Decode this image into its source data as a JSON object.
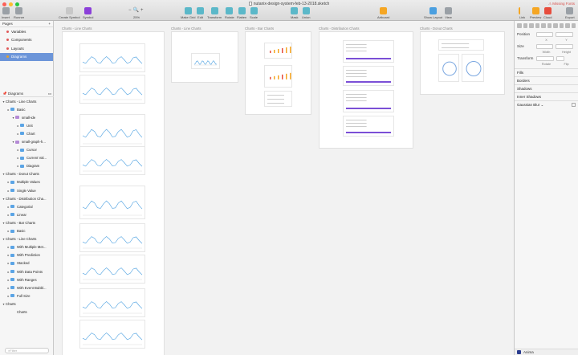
{
  "window": {
    "title": "nutanix-design-system-feb-13-2018.sketch",
    "missing_fonts": "Missing Fonts"
  },
  "toolbar": {
    "insert": "Insert",
    "runner": "Runner",
    "create_symbol": "Create Symbol",
    "symbol": "Symbol",
    "zoom": "25%",
    "make_grid": "Make Grid",
    "edit": "Edit",
    "transform": "Transform",
    "rotate": "Rotate",
    "flatten": "Flatten",
    "scale": "Scale",
    "mask": "Mask",
    "union": "Union",
    "artboard": "Artboard",
    "show_layout": "Show Layout",
    "view": "View",
    "link": "Link",
    "preview": "Preview",
    "cloud": "Cloud",
    "export": "Export"
  },
  "pages": {
    "header": "Pages",
    "items": [
      {
        "label": "Variables",
        "color": "#e05a5a"
      },
      {
        "label": "Components",
        "color": "#e05a5a"
      },
      {
        "label": "Layouts",
        "color": "#e05a5a"
      },
      {
        "label": "Diagrams",
        "color": "#e0a030"
      }
    ]
  },
  "layers": {
    "header": "Diagrams",
    "items": [
      {
        "label": "Charts - Line Charts",
        "level": 0,
        "kind": "board"
      },
      {
        "label": "Basic",
        "level": 1,
        "kind": "folder"
      },
      {
        "label": "small-ide",
        "level": 2,
        "kind": "symbol"
      },
      {
        "label": "Unit",
        "level": 3,
        "kind": "folder"
      },
      {
        "label": "Chart",
        "level": 3,
        "kind": "folder"
      },
      {
        "label": "small-graph-h...",
        "level": 2,
        "kind": "symbol"
      },
      {
        "label": "Cursor",
        "level": 3,
        "kind": "folder"
      },
      {
        "label": "Current Val...",
        "level": 3,
        "kind": "folder"
      },
      {
        "label": "Diagram",
        "level": 3,
        "kind": "folder"
      },
      {
        "label": "Charts - Donut Charts",
        "level": 0,
        "kind": "board"
      },
      {
        "label": "Multiple Values",
        "level": 1,
        "kind": "folder"
      },
      {
        "label": "Single Value",
        "level": 1,
        "kind": "folder"
      },
      {
        "label": "Charts - Distribution Cha...",
        "level": 0,
        "kind": "board"
      },
      {
        "label": "Categorial",
        "level": 1,
        "kind": "folder"
      },
      {
        "label": "Linear",
        "level": 1,
        "kind": "folder"
      },
      {
        "label": "Charts - Bar Charts",
        "level": 0,
        "kind": "board"
      },
      {
        "label": "Basic",
        "level": 1,
        "kind": "folder"
      },
      {
        "label": "Charts - Line Charts",
        "level": 0,
        "kind": "board"
      },
      {
        "label": "With Multiple Met...",
        "level": 1,
        "kind": "folder"
      },
      {
        "label": "With Prediction",
        "level": 1,
        "kind": "folder"
      },
      {
        "label": "Stacked",
        "level": 1,
        "kind": "folder"
      },
      {
        "label": "With Data Points",
        "level": 1,
        "kind": "folder"
      },
      {
        "label": "With Ranges",
        "level": 1,
        "kind": "folder"
      },
      {
        "label": "With Event Bubbl...",
        "level": 1,
        "kind": "folder"
      },
      {
        "label": "Full Size",
        "level": 1,
        "kind": "folder"
      },
      {
        "label": "Charts",
        "level": 0,
        "kind": "board"
      },
      {
        "label": "Charts",
        "level": 1,
        "kind": "none"
      }
    ],
    "filter_placeholder": "Filter"
  },
  "artboards": {
    "line_charts": "Charts - Line Charts",
    "line_charts_2": "Charts - Line Charts",
    "bar_charts": "Charts - Bar Charts",
    "distribution": "Charts - Distribution Charts",
    "donut": "Charts - Donut Charts"
  },
  "inspector": {
    "position": "Position",
    "size": "Size",
    "transform": "Transform",
    "x": "X",
    "y": "Y",
    "width": "Width",
    "height": "Height",
    "rotate": "Rotate",
    "flip": "Flip",
    "fills": "Fills",
    "borders": "Borders",
    "shadows": "Shadows",
    "inner_shadows": "Inner Shadows",
    "gaussian_blur": "Gaussian Blur",
    "anima": "Anima"
  },
  "colors": {
    "selection": "#6c95d9",
    "chart_line": "#4a9fe0",
    "bar_orange": "#f5a623"
  }
}
